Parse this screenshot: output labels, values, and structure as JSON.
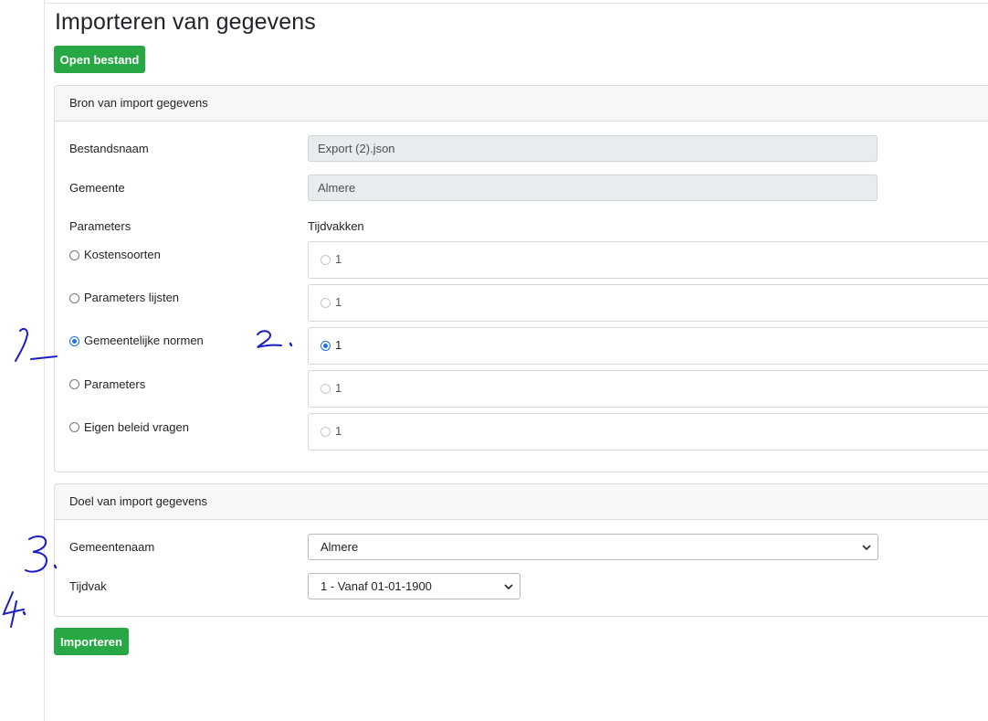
{
  "page": {
    "title": "Importeren van gegevens"
  },
  "buttons": {
    "open_file": "Open bestand",
    "import": "Importeren"
  },
  "source_card": {
    "header": "Bron van import gegevens",
    "filename_label": "Bestandsnaam",
    "filename_value": "Export (2).json",
    "municipality_label": "Gemeente",
    "municipality_value": "Almere",
    "parameters_label": "Parameters",
    "periods_label": "Tijdvakken",
    "parameter_options": [
      {
        "label": "Kostensoorten",
        "checked": false,
        "period": "1",
        "period_checked": false
      },
      {
        "label": "Parameters lijsten",
        "checked": false,
        "period": "1",
        "period_checked": false
      },
      {
        "label": "Gemeentelijke normen",
        "checked": true,
        "period": "1",
        "period_checked": true
      },
      {
        "label": "Parameters",
        "checked": false,
        "period": "1",
        "period_checked": false
      },
      {
        "label": "Eigen beleid vragen",
        "checked": false,
        "period": "1",
        "period_checked": false
      }
    ]
  },
  "target_card": {
    "header": "Doel van import gegevens",
    "municipality_name_label": "Gemeentenaam",
    "municipality_name_value": "Almere",
    "period_label": "Tijdvak",
    "period_value": "1 - Vanaf 01-01-1900"
  },
  "annotations": {
    "color": "#1d1dc4",
    "marks": [
      "1",
      "2",
      "3",
      "4"
    ]
  }
}
